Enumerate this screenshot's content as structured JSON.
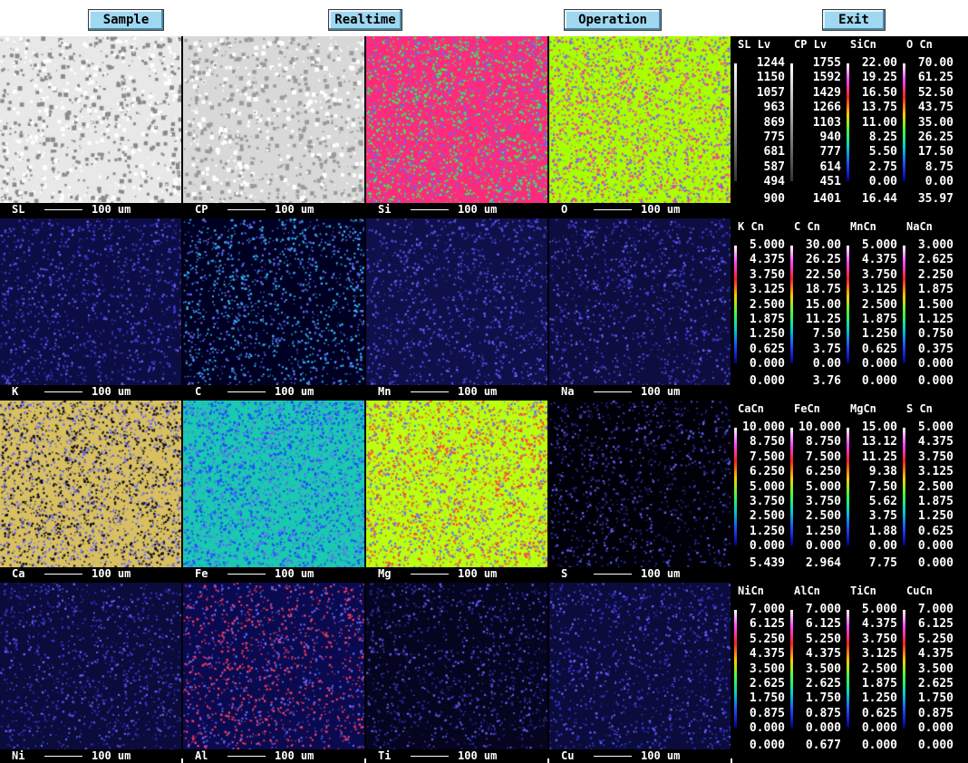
{
  "menu": {
    "sample": "Sample",
    "realtime": "Realtime",
    "operation": "Operation",
    "exit": "Exit"
  },
  "scale_label": "100 um",
  "maps": [
    {
      "label": "SL",
      "style": "sem",
      "c1": "#e8e8e8",
      "c2": "#8a8a8a"
    },
    {
      "label": "CP",
      "style": "sem",
      "c1": "#d8d8d8",
      "c2": "#9a9a9a"
    },
    {
      "label": "Si",
      "style": "color",
      "c1": "#ff2a7a",
      "c2": "#22ff55"
    },
    {
      "label": "O",
      "style": "color",
      "c1": "#a8ff00",
      "c2": "#ff33aa"
    },
    {
      "label": "K",
      "style": "sparse",
      "c1": "#0d0d45",
      "c2": "#3d3dd8"
    },
    {
      "label": "C",
      "style": "sparse2",
      "c1": "#000022",
      "c2": "#33bbff"
    },
    {
      "label": "Mn",
      "style": "sparse",
      "c1": "#0f0f4a",
      "c2": "#4a4ae0"
    },
    {
      "label": "Na",
      "style": "sparse",
      "c1": "#0d0d40",
      "c2": "#3a3ad0"
    },
    {
      "label": "Ca",
      "style": "color",
      "c1": "#d8c060",
      "c2": "#000020"
    },
    {
      "label": "Fe",
      "style": "color",
      "c1": "#1bc8b0",
      "c2": "#1a44ff"
    },
    {
      "label": "Mg",
      "style": "color",
      "c1": "#b8ff10",
      "c2": "#ff4040"
    },
    {
      "label": "S",
      "style": "sparse",
      "c1": "#000008",
      "c2": "#2a2a90"
    },
    {
      "label": "Ni",
      "style": "sparse",
      "c1": "#0b0b3c",
      "c2": "#3434c8"
    },
    {
      "label": "Al",
      "style": "sparse2",
      "c1": "#0a0a50",
      "c2": "#ff4060"
    },
    {
      "label": "Ti",
      "style": "sparse",
      "c1": "#050520",
      "c2": "#2a2aa0"
    },
    {
      "label": "Cu",
      "style": "sparse",
      "c1": "#0b0b3c",
      "c2": "#3434c8"
    }
  ],
  "legends": [
    {
      "heads": [
        "SL Lv",
        "CP Lv",
        "SiCn",
        "O Cn"
      ],
      "cols": [
        [
          "1244",
          "1150",
          "1057",
          "963",
          "869",
          "775",
          "681",
          "587",
          "494",
          "900"
        ],
        [
          "1755",
          "1592",
          "1429",
          "1266",
          "1103",
          "940",
          "777",
          "614",
          "451",
          "1401"
        ],
        [
          "22.00",
          "19.25",
          "16.50",
          "13.75",
          "11.00",
          "8.25",
          "5.50",
          "2.75",
          "0.00",
          "16.44"
        ],
        [
          "70.00",
          "61.25",
          "52.50",
          "43.75",
          "35.00",
          "26.25",
          "17.50",
          "8.75",
          "0.00",
          "35.97"
        ]
      ]
    },
    {
      "heads": [
        "K Cn",
        "C Cn",
        "MnCn",
        "NaCn"
      ],
      "cols": [
        [
          "5.000",
          "4.375",
          "3.750",
          "3.125",
          "2.500",
          "1.875",
          "1.250",
          "0.625",
          "0.000",
          "0.000"
        ],
        [
          "30.00",
          "26.25",
          "22.50",
          "18.75",
          "15.00",
          "11.25",
          "7.50",
          "3.75",
          "0.00",
          "3.76"
        ],
        [
          "5.000",
          "4.375",
          "3.750",
          "3.125",
          "2.500",
          "1.875",
          "1.250",
          "0.625",
          "0.000",
          "0.000"
        ],
        [
          "3.000",
          "2.625",
          "2.250",
          "1.875",
          "1.500",
          "1.125",
          "0.750",
          "0.375",
          "0.000",
          "0.000"
        ]
      ]
    },
    {
      "heads": [
        "CaCn",
        "FeCn",
        "MgCn",
        "S Cn"
      ],
      "cols": [
        [
          "10.000",
          "8.750",
          "7.500",
          "6.250",
          "5.000",
          "3.750",
          "2.500",
          "1.250",
          "0.000",
          "5.439"
        ],
        [
          "10.000",
          "8.750",
          "7.500",
          "6.250",
          "5.000",
          "3.750",
          "2.500",
          "1.250",
          "0.000",
          "2.964"
        ],
        [
          "15.00",
          "13.12",
          "11.25",
          "9.38",
          "7.50",
          "5.62",
          "3.75",
          "1.88",
          "0.00",
          "7.75"
        ],
        [
          "5.000",
          "4.375",
          "3.750",
          "3.125",
          "2.500",
          "1.875",
          "1.250",
          "0.625",
          "0.000",
          "0.000"
        ]
      ]
    },
    {
      "heads": [
        "NiCn",
        "AlCn",
        "TiCn",
        "CuCn"
      ],
      "cols": [
        [
          "7.000",
          "6.125",
          "5.250",
          "4.375",
          "3.500",
          "2.625",
          "1.750",
          "0.875",
          "0.000",
          "0.000"
        ],
        [
          "7.000",
          "6.125",
          "5.250",
          "4.375",
          "3.500",
          "2.625",
          "1.750",
          "0.875",
          "0.000",
          "0.677"
        ],
        [
          "5.000",
          "4.375",
          "3.750",
          "3.125",
          "2.500",
          "1.875",
          "1.250",
          "0.625",
          "0.000",
          "0.000"
        ],
        [
          "7.000",
          "6.125",
          "5.250",
          "4.375",
          "3.500",
          "2.625",
          "1.750",
          "0.875",
          "0.000",
          "0.000"
        ]
      ]
    }
  ],
  "colorbar": {
    "level_colors": [
      "#ffffff",
      "#bbbbbb",
      "#777777",
      "#333333"
    ],
    "conc_colors": [
      "#ffffff",
      "#ff44ff",
      "#ff2222",
      "#ffcc00",
      "#44ff44",
      "#00cccc",
      "#2244ff",
      "#000088"
    ]
  }
}
